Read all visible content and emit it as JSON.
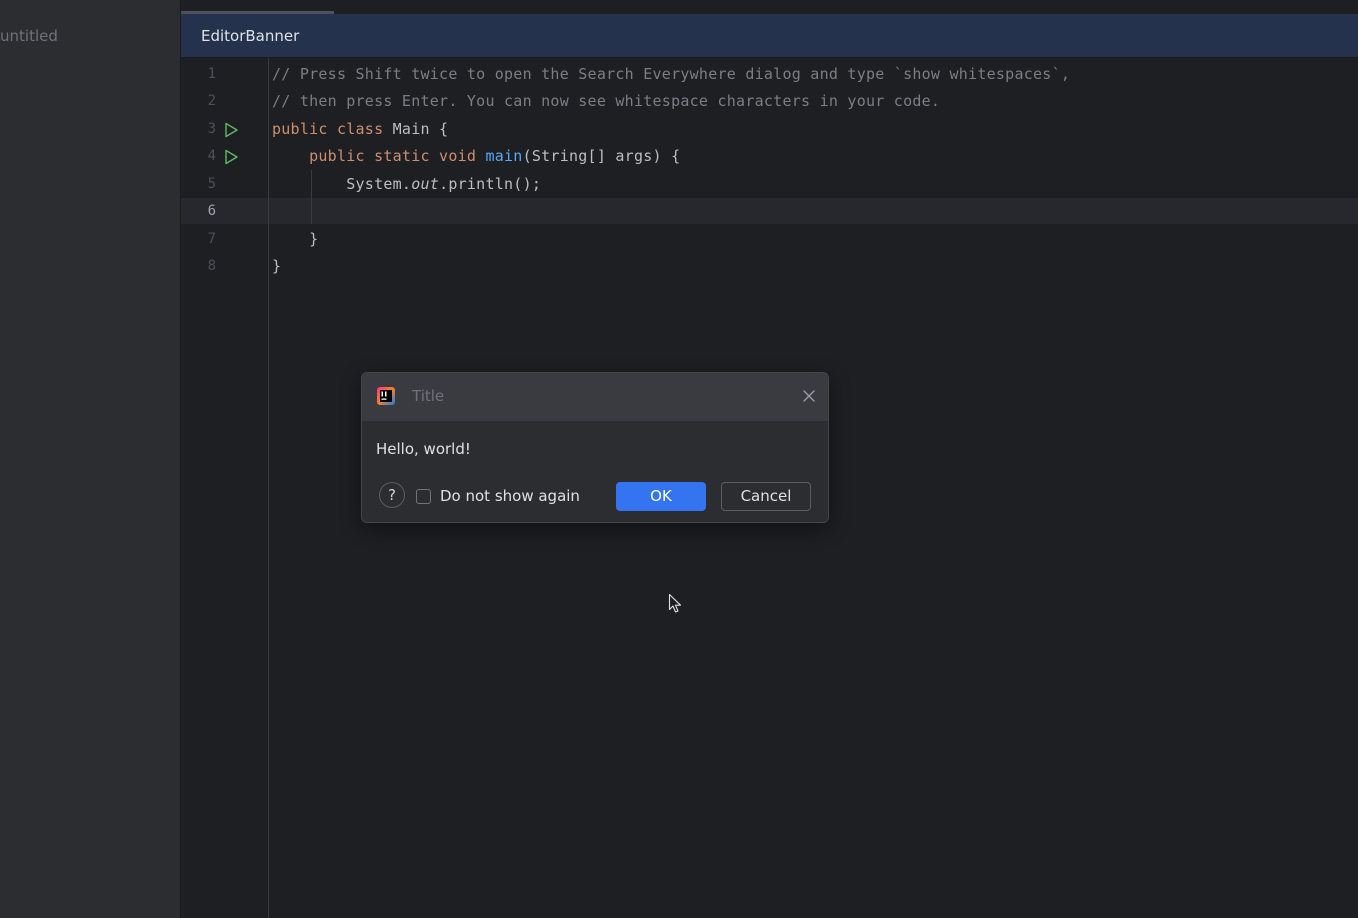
{
  "sidebar": {
    "project_label": "untitled"
  },
  "banner": {
    "text": "EditorBanner"
  },
  "editor": {
    "lines": [
      {
        "number": "1",
        "text": "// Press Shift twice to open the Search Everywhere dialog and type `show whitespaces`,"
      },
      {
        "number": "2",
        "text": "// then press Enter. You can now see whitespace characters in your code."
      },
      {
        "number": "3",
        "kw1": "public class ",
        "rest": "Main {"
      },
      {
        "number": "4",
        "indent": "    ",
        "kw1": "public static void ",
        "fn": "main",
        "rest": "(String[] args) {"
      },
      {
        "number": "5",
        "indent": "        ",
        "pre": "System.",
        "it": "out",
        "rest": ".println();"
      },
      {
        "number": "6",
        "text": ""
      },
      {
        "number": "7",
        "text": "    }"
      },
      {
        "number": "8",
        "text": "}"
      }
    ]
  },
  "dialog": {
    "title": "Title",
    "message": "Hello, world!",
    "help_label": "?",
    "checkbox_label": "Do not show again",
    "checkbox_checked": false,
    "ok_label": "OK",
    "cancel_label": "Cancel"
  },
  "colors": {
    "accent": "#3574f0",
    "banner_bg": "#25324d",
    "keyword": "#cf8e6d",
    "function": "#56a8f5",
    "comment": "#7a7e85"
  }
}
